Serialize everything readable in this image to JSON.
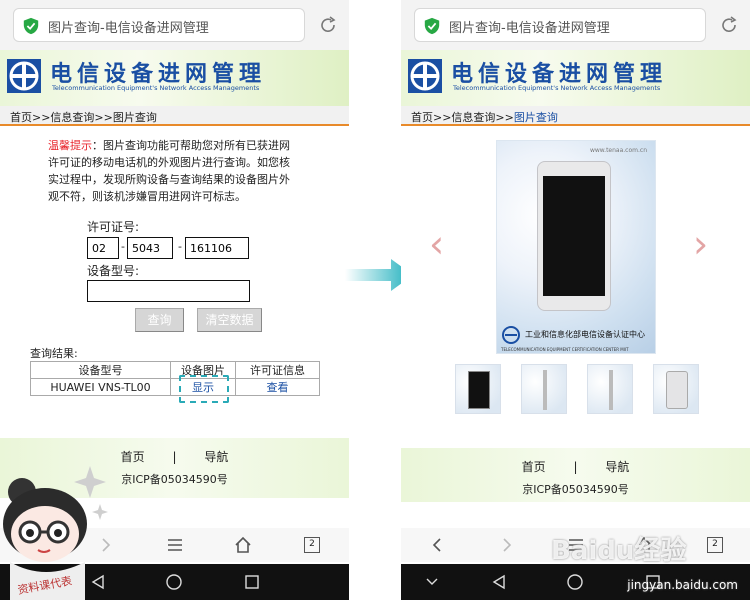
{
  "browser": {
    "address_text": "图片查询-电信设备进网管理",
    "tab_count": "2"
  },
  "site": {
    "title_cn": "电信设备进网管理",
    "title_en": "Telecommunication Equipment's Network Access Managements"
  },
  "left": {
    "breadcrumb": "首页>>信息查询>>图片查询",
    "notice_warn": "温馨提示",
    "notice_text": "：图片查询功能可帮助您对所有已获进网许可证的移动电话机的外观图片进行查询。如您核实过程中，发现所购设备与查询结果的设备图片外观不符，则该机涉嫌冒用进网许可标志。",
    "license_label": "许可证号:",
    "license_part1": "02",
    "license_part2": "5043",
    "license_part3": "161106",
    "dash": "-",
    "model_label": "设备型号:",
    "model_value": "",
    "query_button": "查询",
    "clear_button": "清空数据",
    "result_label": "查询结果:",
    "table_headers": [
      "设备型号",
      "设备图片",
      "许可证信息"
    ],
    "row": {
      "model": "HUAWEI VNS-TL00",
      "image_link": "显示",
      "license_link": "查看"
    }
  },
  "right": {
    "breadcrumb_prefix": "首页>>信息查询>>",
    "breadcrumb_current": "图片查询",
    "photo_site": "www.tenaa.com.cn",
    "photo_caption_cn": "工业和信息化部电信设备认证中心",
    "photo_caption_en": "TELECOMMUNICATION EQUIPMENT CERTIFICATION CENTER MIIT"
  },
  "footer": {
    "home": "首页",
    "separator": "|",
    "nav": "导航",
    "icp": "京ICP备05034590号"
  },
  "watermark": {
    "brand": "Baidu经验",
    "url": "jingyan.baidu.com",
    "mascot_text": "资料课代表"
  },
  "colors": {
    "accent_blue": "#1a4fa3",
    "warning_red": "#e8262c",
    "highlight_teal": "#2aaab7",
    "breadcrumb_orange": "#e88a2a"
  }
}
